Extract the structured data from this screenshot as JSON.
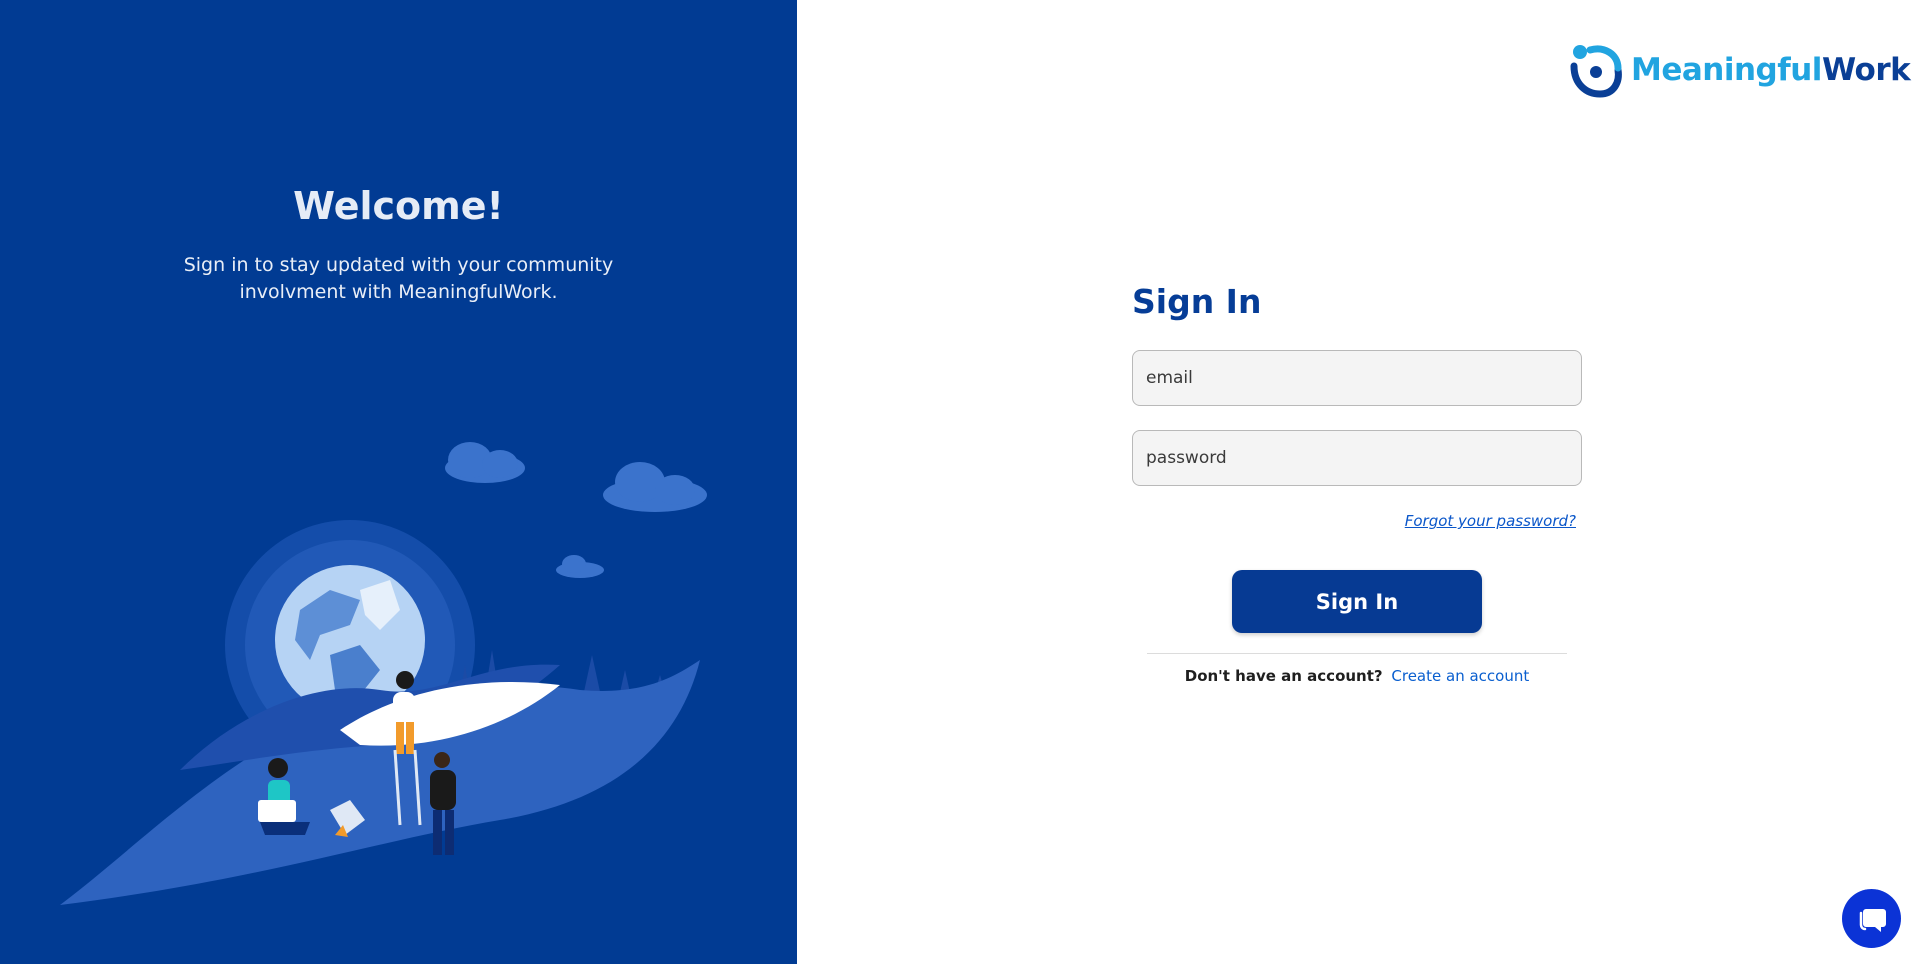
{
  "welcome": {
    "title": "Welcome!",
    "subtitle": "Sign in to stay updated with your community involvment with MeaningfulWork."
  },
  "logo": {
    "part1": "Meaningful",
    "part2": "Work"
  },
  "form": {
    "heading": "Sign In",
    "email_placeholder": "email",
    "password_placeholder": "password",
    "forgot_label": "Forgot your password?",
    "submit_label": "Sign In",
    "no_account_text": "Don't have an account?",
    "create_account_label": "Create an account"
  },
  "icons": {
    "illustration": "globe-people-illustration",
    "logo_mark": "meaningfulwork-logo-icon",
    "chat": "chat-bubble-icon"
  },
  "colors": {
    "panel_blue": "#013b93",
    "accent_blue": "#063a93",
    "link_blue": "#0a5fcf",
    "chat_blue": "#0b33d6"
  }
}
